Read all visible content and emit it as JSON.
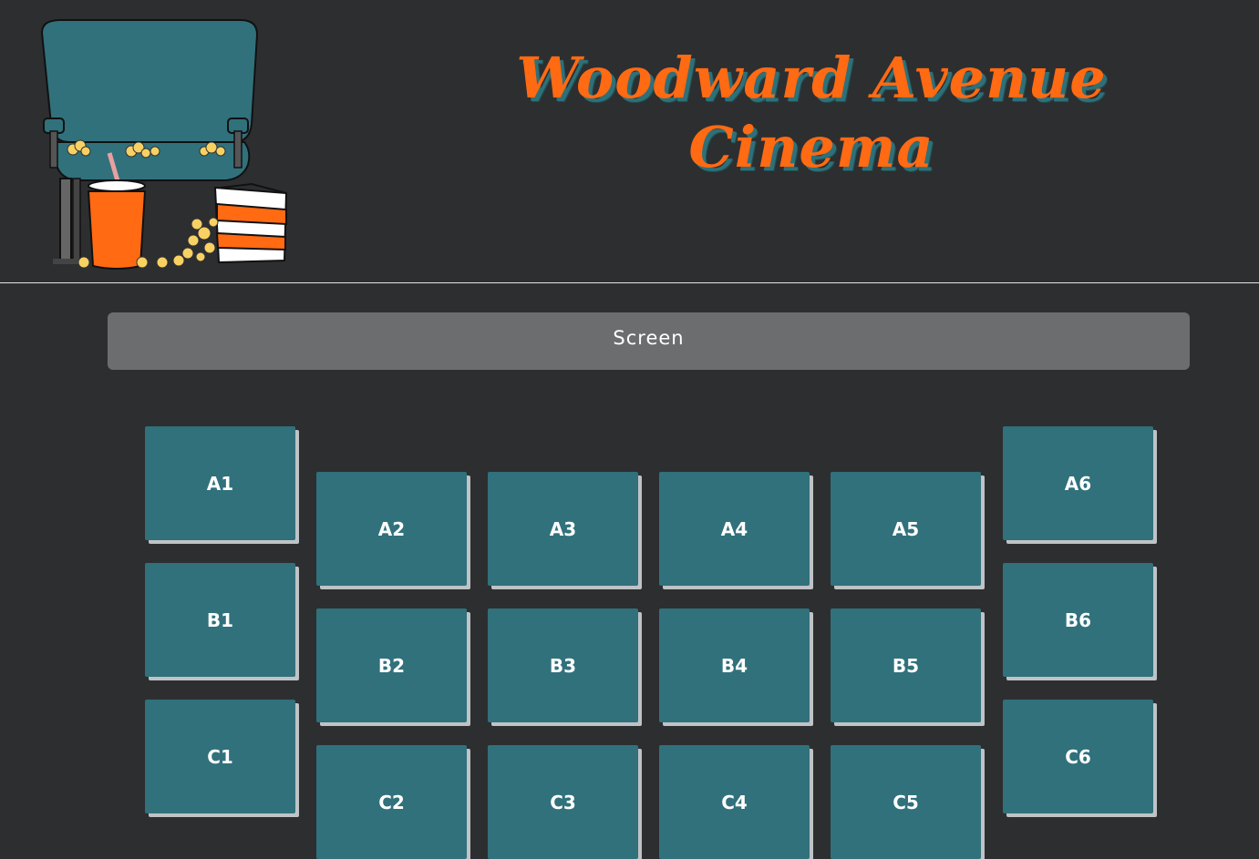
{
  "header": {
    "title_line1": "Woodward Avenue",
    "title_line2": "Cinema",
    "logo_icon": "cinema-seat-popcorn-drink-illustration"
  },
  "screen": {
    "label": "Screen"
  },
  "colors": {
    "background": "#2d2e30",
    "accent_orange": "#ff6a13",
    "seat_teal": "#30717c",
    "screen_gray": "#6c6d6f",
    "seat_shadow": "#bfc3c6"
  },
  "seats": [
    {
      "label": "A1"
    },
    {
      "label": "A2"
    },
    {
      "label": "A3"
    },
    {
      "label": "A4"
    },
    {
      "label": "A5"
    },
    {
      "label": "A6"
    },
    {
      "label": "B1"
    },
    {
      "label": "B2"
    },
    {
      "label": "B3"
    },
    {
      "label": "B4"
    },
    {
      "label": "B5"
    },
    {
      "label": "B6"
    },
    {
      "label": "C1"
    },
    {
      "label": "C2"
    },
    {
      "label": "C3"
    },
    {
      "label": "C4"
    },
    {
      "label": "C5"
    },
    {
      "label": "C6"
    }
  ]
}
